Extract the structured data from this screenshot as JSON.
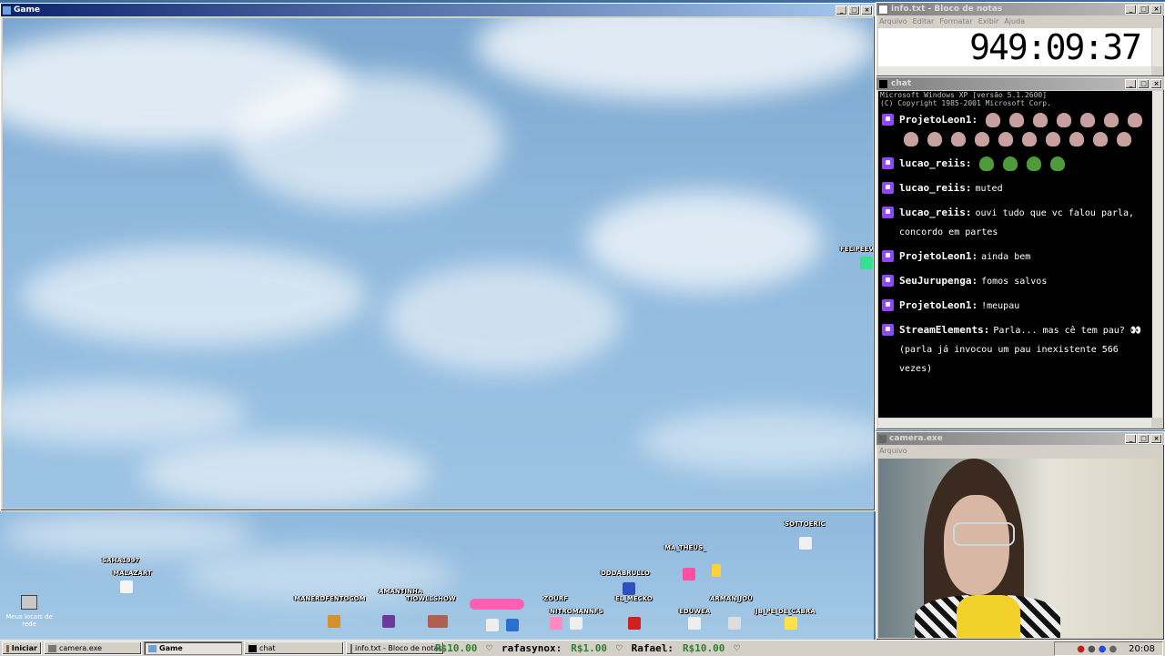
{
  "game_window": {
    "title": "Game",
    "overlay_names": [
      "FELIPEEVERS"
    ],
    "strip_names": [
      "SAHA1997",
      "MALAZART",
      "MANERDFENTOCOM",
      "AMANTINHA",
      "TIOWLLSHOW",
      "ZOURF",
      "NITROMANNFS",
      "DDDABRULLO",
      "EL_MECKO",
      "MA_THEUS_",
      "ARMAN_JOU",
      "EDUWEA",
      "JB_PE_DE_CABRA",
      "SOTTOERIC"
    ]
  },
  "info_window": {
    "title": "info.txt - Bloco de notas",
    "menu": [
      "Arquivo",
      "Editar",
      "Formatar",
      "Exibir",
      "Ajuda"
    ],
    "content": "949:09:37"
  },
  "chat_window": {
    "title": "chat",
    "header_line1": "Microsoft Windows XP [versão 5.1.2600]",
    "header_line2": "(C) Copyright 1985-2001 Microsoft Corp.",
    "messages": [
      {
        "user": "ProjetoLeon1:",
        "text": "",
        "emotes": 17,
        "emote_color": "#c9a0a0"
      },
      {
        "user": "lucao_reiis:",
        "text": "",
        "emotes": 4,
        "emote_color": "#4f9a3a"
      },
      {
        "user": "lucao_reiis:",
        "text": "muted",
        "emotes": 0
      },
      {
        "user": "lucao_reiis:",
        "text": "ouvi tudo que vc falou parla, concordo em partes",
        "emotes": 0
      },
      {
        "user": "ProjetoLeon1:",
        "text": "ainda bem",
        "emotes": 0
      },
      {
        "user": "SeuJurupenga:",
        "text": "fomos salvos",
        "emotes": 0
      },
      {
        "user": "ProjetoLeon1:",
        "text": "!meupau",
        "emotes": 0
      },
      {
        "user": "StreamElements:",
        "text": "Parla... mas cê tem pau? 👀 (parla já invocou um pau inexistente 566 vezes)",
        "emotes": 0
      }
    ]
  },
  "camera_window": {
    "title": "camera.exe",
    "menu": [
      "Arquivo"
    ]
  },
  "desktop_icon": {
    "label": "Meus locais de rede",
    "icon": "network-icon"
  },
  "taskbar": {
    "start_label": "Iniciar",
    "buttons": [
      {
        "label": "camera.exe",
        "active": false
      },
      {
        "label": "Game",
        "active": true
      },
      {
        "label": "chat",
        "active": false
      },
      {
        "label": "info.txt - Bloco de notas",
        "active": false
      }
    ],
    "ticker": [
      {
        "amount": "R$10.00",
        "name": ""
      },
      {
        "amount": "R$1.00",
        "name": "rafasynox:"
      },
      {
        "amount": "R$10.00",
        "name": "Rafael:"
      }
    ],
    "clock": "20:08"
  },
  "colors": {
    "titlebar_active": "#0a246a",
    "desktop": "#3a6ea5",
    "twitch_badge": "#9146ff"
  }
}
